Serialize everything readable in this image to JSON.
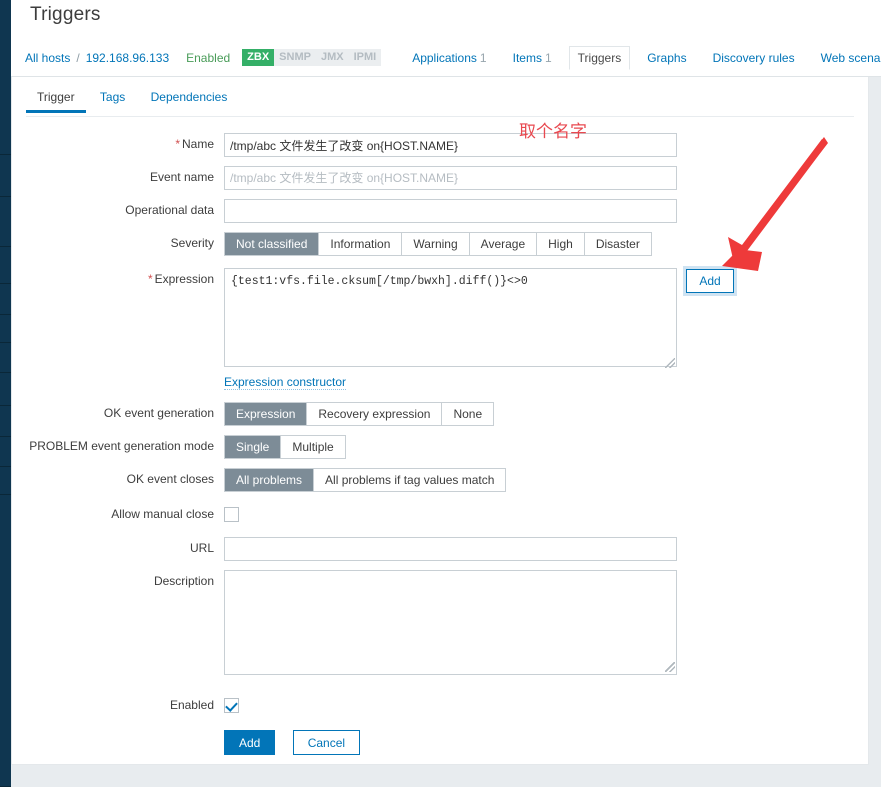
{
  "page": {
    "title": "Triggers"
  },
  "objnav": {
    "all_hosts": "All hosts",
    "separator": "/",
    "host": "192.168.96.133",
    "status": "Enabled",
    "badges": [
      {
        "label": "ZBX",
        "active": true
      },
      {
        "label": "SNMP",
        "active": false
      },
      {
        "label": "JMX",
        "active": false
      },
      {
        "label": "IPMI",
        "active": false
      }
    ],
    "tabs": [
      {
        "label": "Applications",
        "count": "1",
        "selected": false
      },
      {
        "label": "Items",
        "count": "1",
        "selected": false
      },
      {
        "label": "Triggers",
        "count": "",
        "selected": true
      },
      {
        "label": "Graphs",
        "count": "",
        "selected": false
      },
      {
        "label": "Discovery rules",
        "count": "",
        "selected": false
      },
      {
        "label": "Web scenarios",
        "count": "",
        "selected": false
      }
    ]
  },
  "form_tabs": [
    {
      "label": "Trigger",
      "active": true
    },
    {
      "label": "Tags",
      "active": false
    },
    {
      "label": "Dependencies",
      "active": false
    }
  ],
  "form": {
    "name": {
      "label": "Name",
      "required": true,
      "value": "/tmp/abc 文件发生了改变 on{HOST.NAME}"
    },
    "event_name": {
      "label": "Event name",
      "value": "",
      "placeholder": "/tmp/abc 文件发生了改变 on{HOST.NAME}"
    },
    "operational_data": {
      "label": "Operational data",
      "value": ""
    },
    "severity": {
      "label": "Severity",
      "options": [
        "Not classified",
        "Information",
        "Warning",
        "Average",
        "High",
        "Disaster"
      ],
      "selected": "Not classified"
    },
    "expression": {
      "label": "Expression",
      "required": true,
      "value": "{test1:vfs.file.cksum[/tmp/bwxh].diff()}<>0",
      "add_button": "Add",
      "constructor_link": "Expression constructor"
    },
    "ok_event_generation": {
      "label": "OK event generation",
      "options": [
        "Expression",
        "Recovery expression",
        "None"
      ],
      "selected": "Expression"
    },
    "problem_event_generation_mode": {
      "label": "PROBLEM event generation mode",
      "options": [
        "Single",
        "Multiple"
      ],
      "selected": "Single"
    },
    "ok_event_closes": {
      "label": "OK event closes",
      "options": [
        "All problems",
        "All problems if tag values match"
      ],
      "selected": "All problems"
    },
    "allow_manual_close": {
      "label": "Allow manual close",
      "checked": false
    },
    "url": {
      "label": "URL",
      "value": ""
    },
    "description": {
      "label": "Description",
      "value": ""
    },
    "enabled": {
      "label": "Enabled",
      "checked": true
    }
  },
  "actions": {
    "submit": "Add",
    "cancel": "Cancel"
  },
  "annotations": {
    "name_hint": "取个名字",
    "arrow_color": "#ee3a3a",
    "text_color": "#e8484f"
  }
}
